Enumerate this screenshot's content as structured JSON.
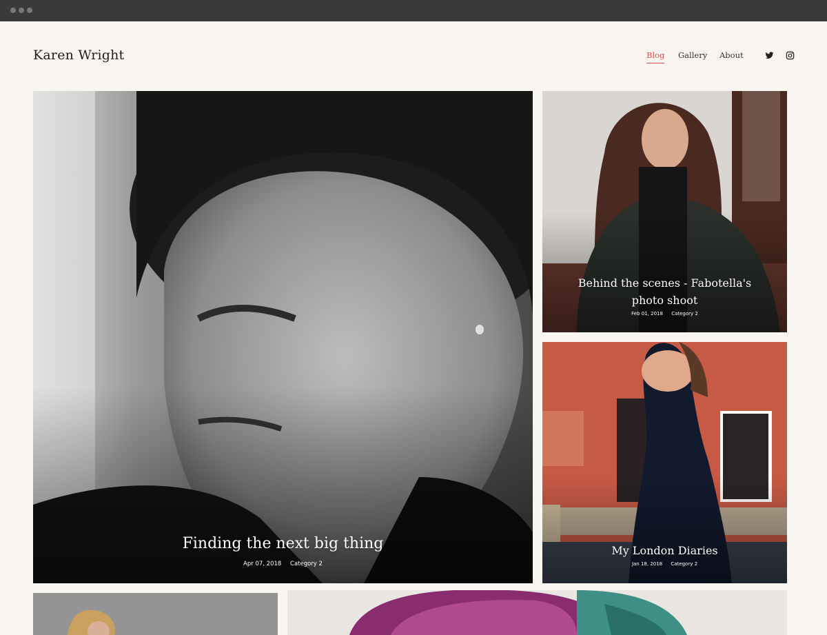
{
  "site": {
    "title": "Karen Wright"
  },
  "nav": {
    "items": [
      {
        "label": "Blog",
        "active": true
      },
      {
        "label": "Gallery",
        "active": false
      },
      {
        "label": "About",
        "active": false
      }
    ]
  },
  "social": {
    "icons": [
      "twitter-icon",
      "instagram-icon"
    ]
  },
  "posts": [
    {
      "title": "Finding the next big thing",
      "date": "Apr 07, 2018",
      "category": "Category 2"
    },
    {
      "title": "Behind the scenes - Fabotella's photo shoot",
      "date": "Feb 01, 2018",
      "category": "Category 2"
    },
    {
      "title": "My London Diaries",
      "date": "Jan 18, 2018",
      "category": "Category 2"
    }
  ],
  "colors": {
    "accent": "#d34f4f",
    "background": "#f9f5f0",
    "chrome": "#3a3a3a"
  }
}
